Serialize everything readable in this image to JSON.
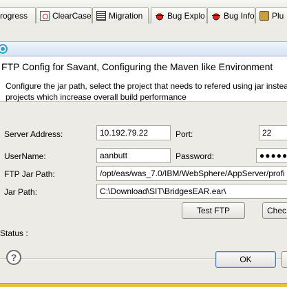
{
  "tabs": [
    {
      "label": "rogress",
      "icon": "none"
    },
    {
      "label": "ClearCase",
      "icon": "clearcase-icon"
    },
    {
      "label": "Migration",
      "icon": "migration-icon"
    },
    {
      "label": "Bug Explo",
      "icon": "bug-icon"
    },
    {
      "label": "Bug Info",
      "icon": "bug-icon"
    },
    {
      "label": "Plu",
      "icon": "plugin-icon"
    }
  ],
  "dialog": {
    "header_title": "FTP Config for Savant, Configuring the Maven like Environment",
    "description_line1": "Configure the jar path, select the project that needs to refered using jar instead",
    "description_line2": "projects which increase overall build performance",
    "form": {
      "server_address_label": "Server Address:",
      "server_address_value": "10.192.79.22",
      "port_label": "Port:",
      "port_value": "22",
      "username_label": "UserName:",
      "username_value": "aanbutt",
      "password_label": "Password:",
      "password_value": "●●●●●●●●",
      "ftp_jar_path_label": "FTP Jar Path:",
      "ftp_jar_path_value": "/opt/eas/was_7.0/IBM/WebSphere/AppServer/profi",
      "jar_path_label": "Jar Path:",
      "jar_path_value": "C:\\Download\\SIT\\BridgesEAR.ear\\"
    },
    "test_ftp_label": "Test FTP",
    "check_label": "Chec",
    "status_label": "Status :",
    "ok_label": "OK",
    "help_glyph": "?",
    "colors": {
      "accent": "#27a7c8",
      "window_border": "#e8c23a"
    }
  }
}
